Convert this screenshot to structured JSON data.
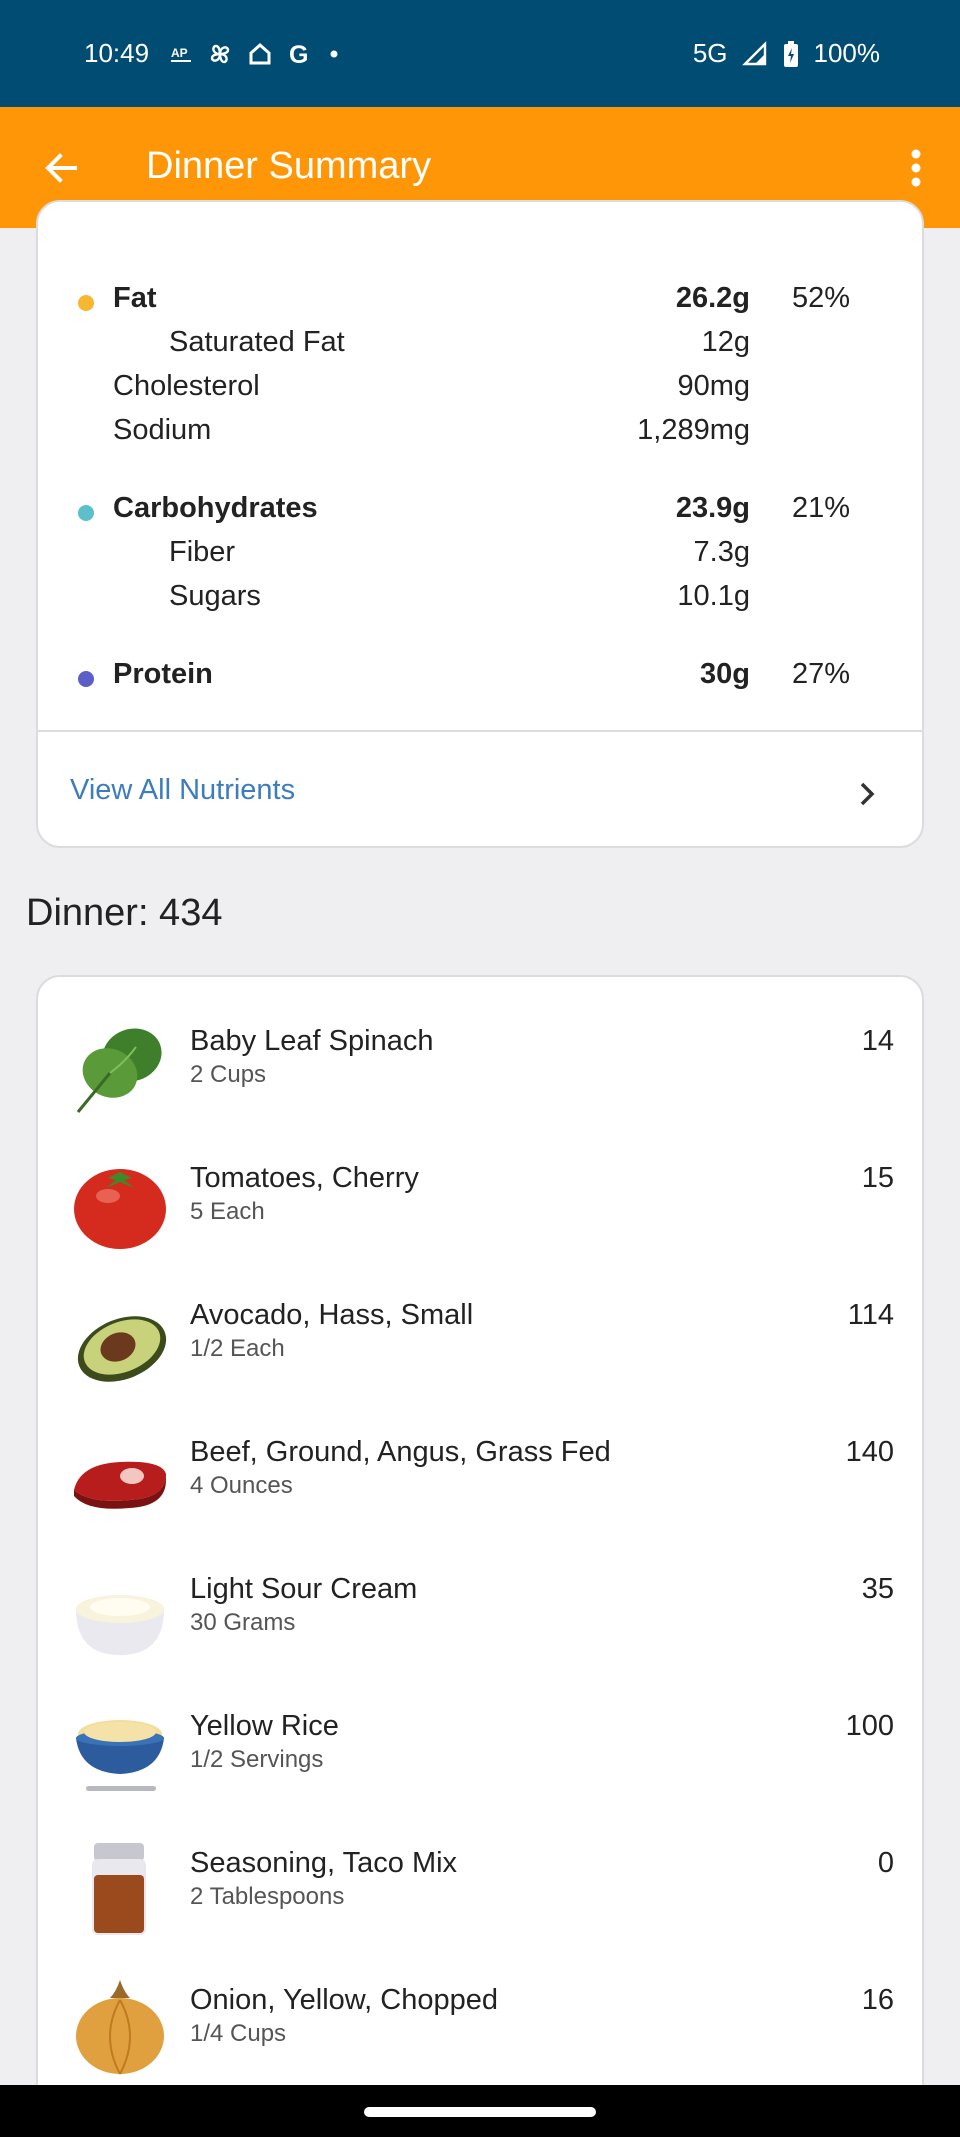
{
  "status_bar": {
    "time": "10:49",
    "left_icons": [
      "ap-news-icon",
      "pinwheel-icon",
      "home-icon",
      "google-icon",
      "dot-icon"
    ],
    "network": "5G",
    "battery": "100%"
  },
  "app_bar": {
    "title": "Dinner Summary"
  },
  "nutrients": {
    "fat": {
      "label": "Fat",
      "amount": "26.2g",
      "pct": "52%",
      "color": "#f7b731"
    },
    "saturated_fat": {
      "label": "Saturated Fat",
      "amount": "12g"
    },
    "cholesterol": {
      "label": "Cholesterol",
      "amount": "90mg"
    },
    "sodium": {
      "label": "Sodium",
      "amount": "1,289mg"
    },
    "carbohydrates": {
      "label": "Carbohydrates",
      "amount": "23.9g",
      "pct": "21%",
      "color": "#5bc0cc"
    },
    "fiber": {
      "label": "Fiber",
      "amount": "7.3g"
    },
    "sugars": {
      "label": "Sugars",
      "amount": "10.1g"
    },
    "protein": {
      "label": "Protein",
      "amount": "30g",
      "pct": "27%",
      "color": "#5b5fc7"
    },
    "view_all": "View All Nutrients"
  },
  "meal": {
    "heading": "Dinner: 434"
  },
  "foods": [
    {
      "name": "Baby Leaf Spinach",
      "portion": "2 Cups",
      "calories": "14",
      "icon": "spinach-icon"
    },
    {
      "name": "Tomatoes, Cherry",
      "portion": "5 Each",
      "calories": "15",
      "icon": "tomato-icon"
    },
    {
      "name": "Avocado, Hass, Small",
      "portion": "1/2 Each",
      "calories": "114",
      "icon": "avocado-icon"
    },
    {
      "name": "Beef, Ground, Angus, Grass Fed",
      "portion": "4 Ounces",
      "calories": "140",
      "icon": "steak-icon"
    },
    {
      "name": "Light Sour Cream",
      "portion": "30 Grams",
      "calories": "35",
      "icon": "sour-cream-icon"
    },
    {
      "name": "Yellow Rice",
      "portion": "1/2 Servings",
      "calories": "100",
      "icon": "rice-bowl-icon"
    },
    {
      "name": "Seasoning, Taco Mix",
      "portion": "2 Tablespoons",
      "calories": "0",
      "icon": "spice-jar-icon"
    },
    {
      "name": "Onion, Yellow, Chopped",
      "portion": "1/4 Cups",
      "calories": "16",
      "icon": "onion-icon"
    }
  ],
  "colors": {
    "status_bar": "#004c72",
    "app_bar": "#ff9607",
    "link": "#3d7dbd"
  }
}
